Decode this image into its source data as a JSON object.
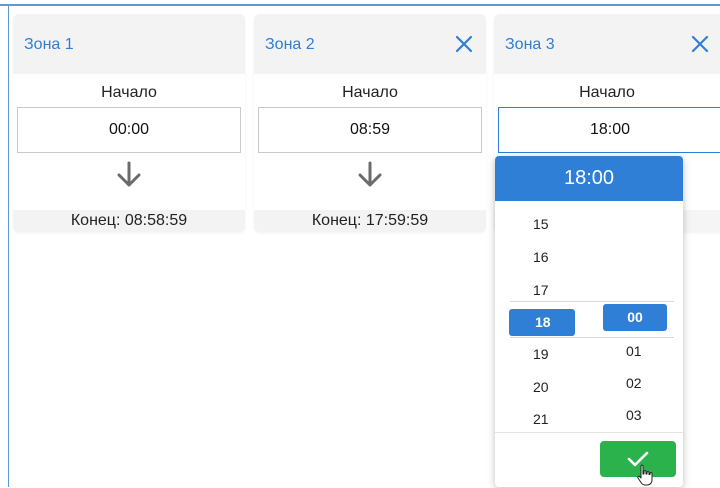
{
  "zones": [
    {
      "title": "Зона 1",
      "start_label": "Начало",
      "start_value": "00:00",
      "end_text": "Конец: 08:58:59",
      "closable": false
    },
    {
      "title": "Зона 2",
      "start_label": "Начало",
      "start_value": "08:59",
      "end_text": "Конец: 17:59:59",
      "closable": true
    },
    {
      "title": "Зона 3",
      "start_label": "Начало",
      "start_value": "18:00",
      "closable": true
    }
  ],
  "picker": {
    "selected": "18:00",
    "hours": [
      "15",
      "16",
      "17",
      "18",
      "19",
      "20",
      "21"
    ],
    "minutes": [
      "00",
      "01",
      "02",
      "03"
    ],
    "selected_hour": "18",
    "selected_minute": "00"
  },
  "icons": {
    "close": "close-icon",
    "arrow": "arrow-down-icon",
    "confirm": "checkmark-icon",
    "cursor": "hand-pointer-icon"
  },
  "colors": {
    "accent": "#2f7fd6",
    "confirm": "#2bb24c"
  }
}
